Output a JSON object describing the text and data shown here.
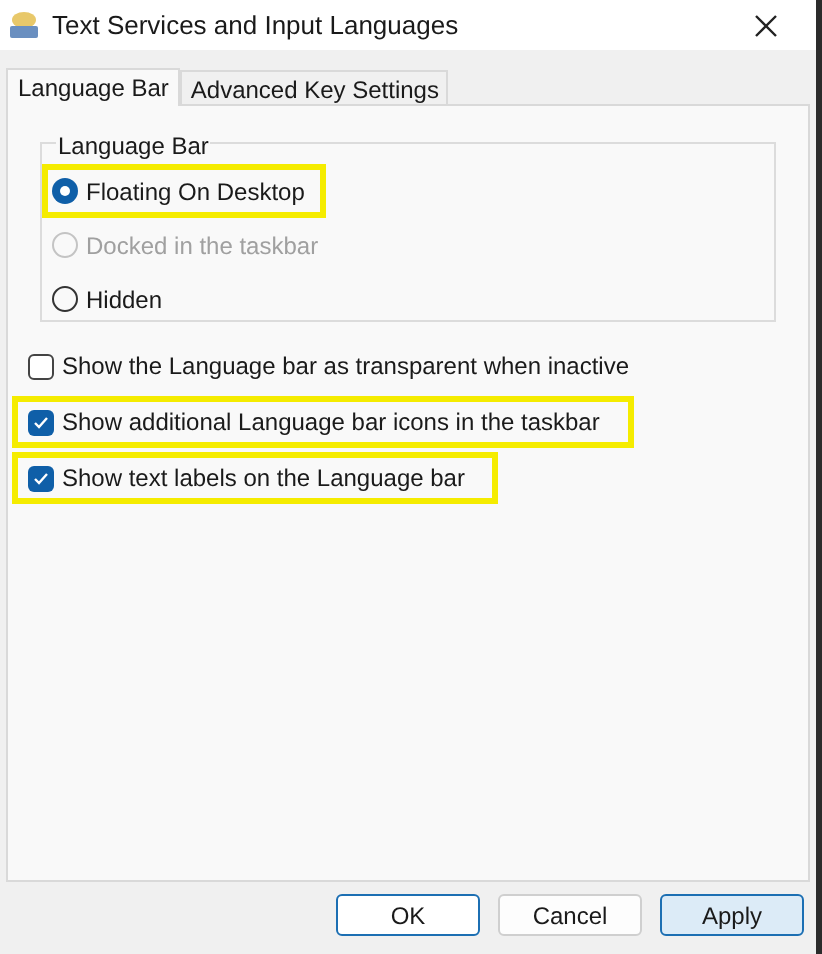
{
  "window": {
    "title": "Text Services and Input Languages"
  },
  "tabs": [
    {
      "label": "Language Bar",
      "selected": true
    },
    {
      "label": "Advanced Key Settings",
      "selected": false
    }
  ],
  "group": {
    "title": "Language Bar",
    "options": [
      {
        "label": "Floating On Desktop",
        "selected": true,
        "disabled": false,
        "highlighted": true
      },
      {
        "label": "Docked in the taskbar",
        "selected": false,
        "disabled": true,
        "highlighted": false
      },
      {
        "label": "Hidden",
        "selected": false,
        "disabled": false,
        "highlighted": false
      }
    ]
  },
  "checkboxes": [
    {
      "label": "Show the Language bar as transparent when inactive",
      "checked": false,
      "highlighted": false
    },
    {
      "label": "Show additional Language bar icons in the taskbar",
      "checked": true,
      "highlighted": true
    },
    {
      "label": "Show text labels on the Language bar",
      "checked": true,
      "highlighted": true
    }
  ],
  "buttons": [
    {
      "label": "OK",
      "kind": "default"
    },
    {
      "label": "Cancel",
      "kind": "normal"
    },
    {
      "label": "Apply",
      "kind": "focused"
    }
  ]
}
